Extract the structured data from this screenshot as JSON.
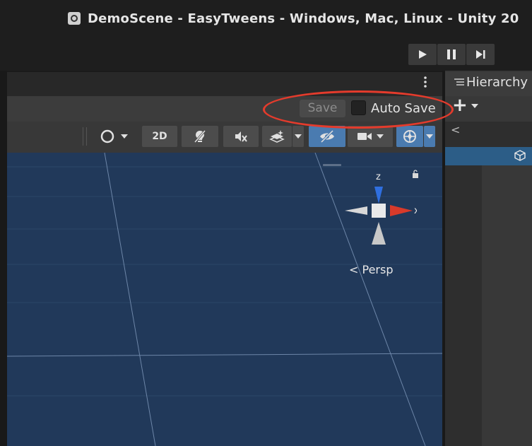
{
  "window": {
    "title": "DemoScene - EasyTweens - Windows, Mac, Linux - Unity 20",
    "icon": "unity-scene-icon"
  },
  "playbar": {
    "buttons": [
      {
        "name": "play-button",
        "icon": "play-icon"
      },
      {
        "name": "pause-button",
        "icon": "pause-icon"
      },
      {
        "name": "step-button",
        "icon": "step-icon"
      }
    ]
  },
  "scene": {
    "prefab_bar": {
      "save_label": "Save",
      "autosave_label": "Auto Save",
      "autosave_checked": false
    },
    "toolbar": {
      "view_2d_label": "2D"
    },
    "gizmo": {
      "axis_z": "z",
      "axis_x": "x",
      "projection_label": "Persp"
    },
    "colors": {
      "viewport": "#21395a",
      "axis_z": "#2f6fe0",
      "axis_x": "#d83a2a",
      "highlight": "#e43b2c"
    }
  },
  "hierarchy": {
    "title": "Hierarchy",
    "add_label": "+"
  }
}
